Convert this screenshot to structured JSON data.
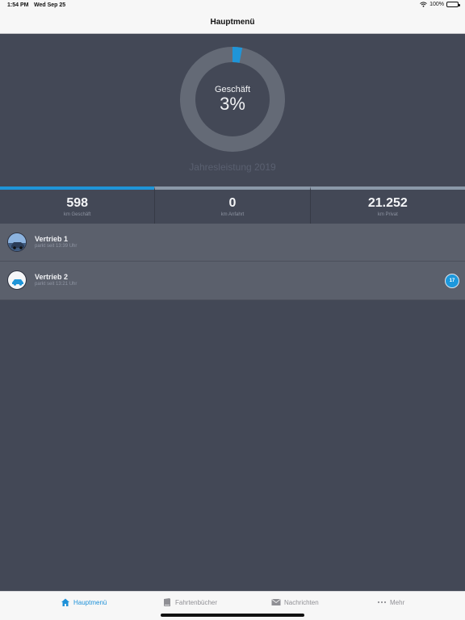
{
  "status_bar": {
    "time": "1:54 PM",
    "date": "Wed Sep 25",
    "battery": "100%"
  },
  "nav": {
    "title": "Hauptmenü"
  },
  "summary": {
    "donut_label": "Geschäft",
    "donut_value": "3%",
    "business_fraction": 0.03,
    "year_label": "Jahresleistung 2019"
  },
  "stats": [
    {
      "value": "598",
      "label": "km Geschäft"
    },
    {
      "value": "0",
      "label": "km Anfahrt"
    },
    {
      "value": "21.252",
      "label": "km Privat"
    }
  ],
  "vehicles": [
    {
      "name": "Vertrieb 1",
      "status": "parkt seit 13:39 Uhr",
      "badge": ""
    },
    {
      "name": "Vertrieb 2",
      "status": "parkt seit 13:21 Uhr",
      "badge": "17"
    }
  ],
  "tabs": [
    {
      "label": "Hauptmenü",
      "icon": "home-icon",
      "active": true
    },
    {
      "label": "Fahrtenbücher",
      "icon": "book-icon",
      "active": false
    },
    {
      "label": "Nachrichten",
      "icon": "mail-icon",
      "active": false
    },
    {
      "label": "Mehr",
      "icon": "more-icon",
      "active": false
    }
  ],
  "colors": {
    "background": "#434856",
    "accent": "#1f95d8",
    "ring": "#646a76",
    "row": "#5b606c"
  }
}
